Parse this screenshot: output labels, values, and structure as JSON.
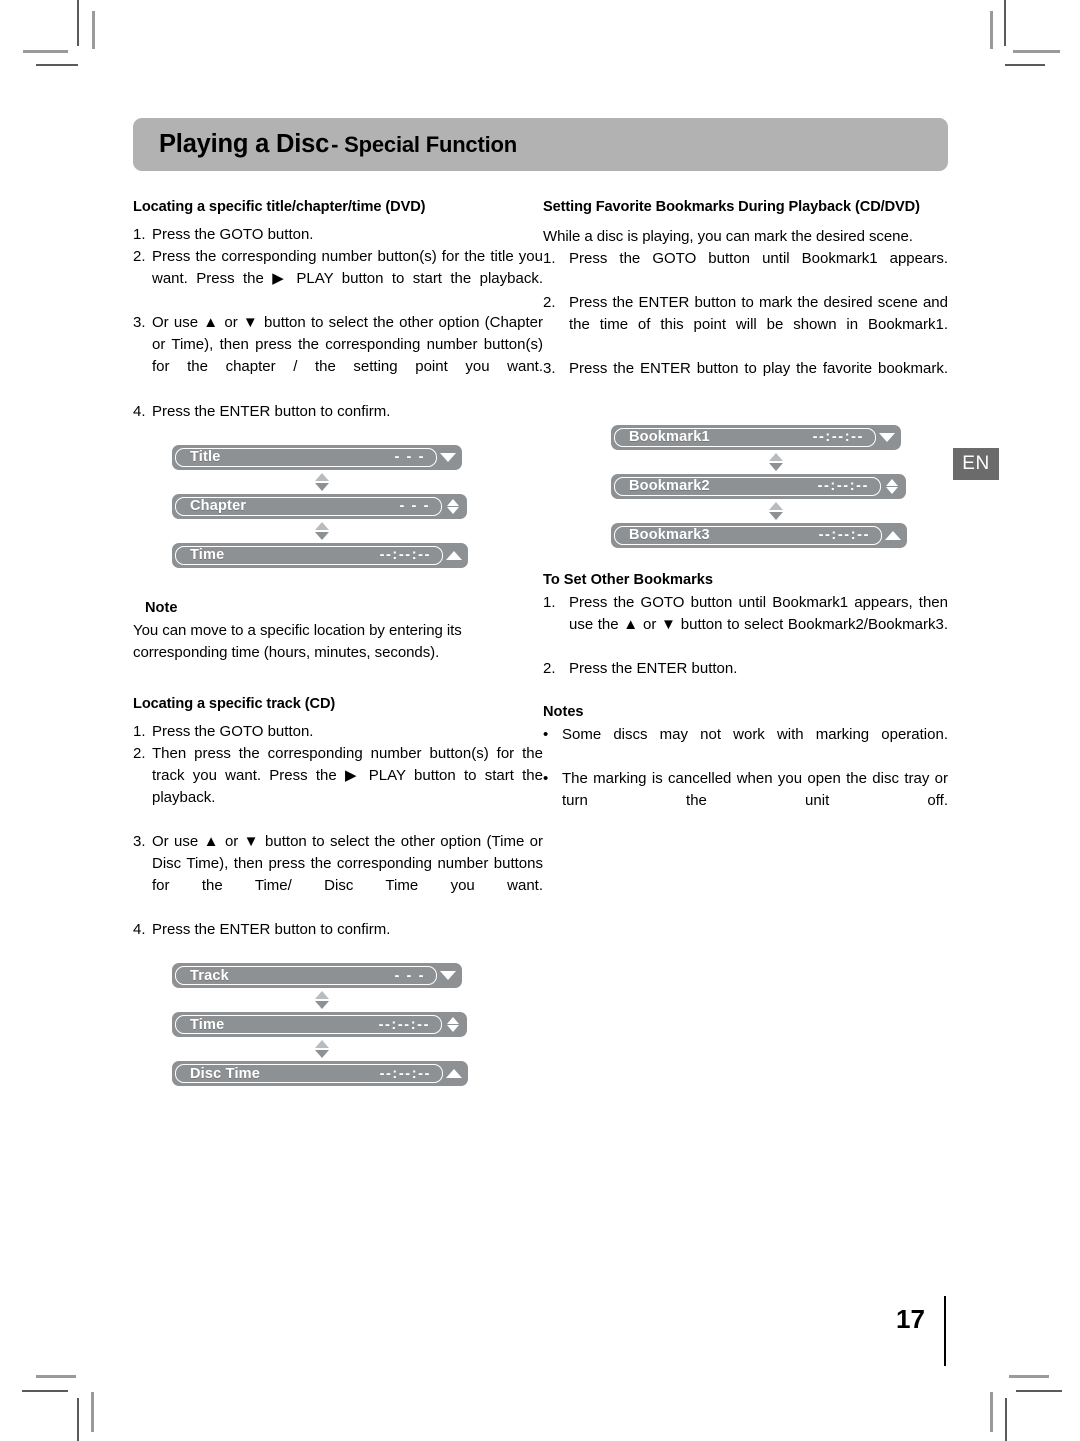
{
  "header": {
    "title_bold": "Playing a Disc",
    "title_rest": "- Special Function"
  },
  "badge": {
    "language": "EN"
  },
  "footer": {
    "page_number": "17"
  },
  "left_column": {
    "section1_heading": "Locating a specific title/chapter/time (DVD)",
    "section1_steps": [
      {
        "num": "1.",
        "text": "Press the GOTO button."
      },
      {
        "num": "2.",
        "text": "Press the corresponding number button(s) for the title you want. Press the ▶ PLAY button to start the playback."
      },
      {
        "num": "3.",
        "text": "Or use ▲ or ▼ button to select the other option (Chapter or Time), then press the corresponding number button(s) for the chapter / the setting point you want."
      },
      {
        "num": "4.",
        "text": "Press the ENTER button to confirm."
      }
    ],
    "osd_dvd": {
      "rows": [
        {
          "label": "Title",
          "value": "- - -",
          "side_icon": "triangle-down-icon"
        },
        {
          "label": "Chapter",
          "value": "- - -",
          "side_icon": "triangle-up-down-icon"
        },
        {
          "label": "Time",
          "value": "--:--:--",
          "side_icon": "triangle-up-icon"
        }
      ]
    },
    "note_heading": "Note",
    "note_text": "You can move to a specific location by entering its corresponding time (hours, minutes, seconds).",
    "section2_heading": "Locating a specific track (CD)",
    "section2_steps": [
      {
        "num": "1.",
        "text": "Press the GOTO button."
      },
      {
        "num": "2.",
        "text": "Then press the corresponding number button(s) for the track you want. Press the ▶ PLAY button to start the playback."
      },
      {
        "num": "3.",
        "text": "Or use ▲ or ▼ button to select the other option (Time or Disc Time), then press the corresponding number buttons for the Time/ Disc Time you want."
      },
      {
        "num": "4.",
        "text": "Press the ENTER button to confirm."
      }
    ],
    "osd_cd": {
      "rows": [
        {
          "label": "Track",
          "value": "- - -",
          "side_icon": "triangle-down-icon"
        },
        {
          "label": "Time",
          "value": "--:--:--",
          "side_icon": "triangle-up-down-icon"
        },
        {
          "label": "Disc Time",
          "value": "--:--:--",
          "side_icon": "triangle-up-icon"
        }
      ]
    }
  },
  "right_column": {
    "section1_heading": "Setting Favorite Bookmarks During Playback (CD/DVD)",
    "section1_intro": "While a disc is playing, you can mark the desired scene.",
    "section1_steps": [
      {
        "num": "1.",
        "text": "Press the GOTO button until Bookmark1 appears."
      },
      {
        "num": "2.",
        "text": "Press the ENTER button to mark the desired scene and the time of this point will be shown in Bookmark1."
      },
      {
        "num": "3.",
        "text": "Press the ENTER button to play the favorite bookmark."
      }
    ],
    "osd_bookmarks": {
      "rows": [
        {
          "label": "Bookmark1",
          "value": "--:--:--",
          "side_icon": "triangle-down-icon"
        },
        {
          "label": "Bookmark2",
          "value": "--:--:--",
          "side_icon": "triangle-up-down-icon"
        },
        {
          "label": "Bookmark3",
          "value": "--:--:--",
          "side_icon": "triangle-up-icon"
        }
      ]
    },
    "section2_heading": "To Set Other Bookmarks",
    "section2_steps": [
      {
        "num": "1.",
        "text": "Press the GOTO button until Bookmark1 appears, then use the ▲ or ▼ button to select Bookmark2/Bookmark3."
      },
      {
        "num": "2.",
        "text": "Press the ENTER button."
      }
    ],
    "notes_heading": "Notes",
    "notes": [
      {
        "bullet": "•",
        "text": "Some discs may not work with marking operation."
      },
      {
        "bullet": "•",
        "text": "The marking is cancelled when you open the disc tray or turn the unit off."
      }
    ]
  },
  "colors": {
    "header_bar": "#b2b2b2",
    "osd_bar": "#8d9194",
    "badge_bg": "#6b6b6b"
  }
}
